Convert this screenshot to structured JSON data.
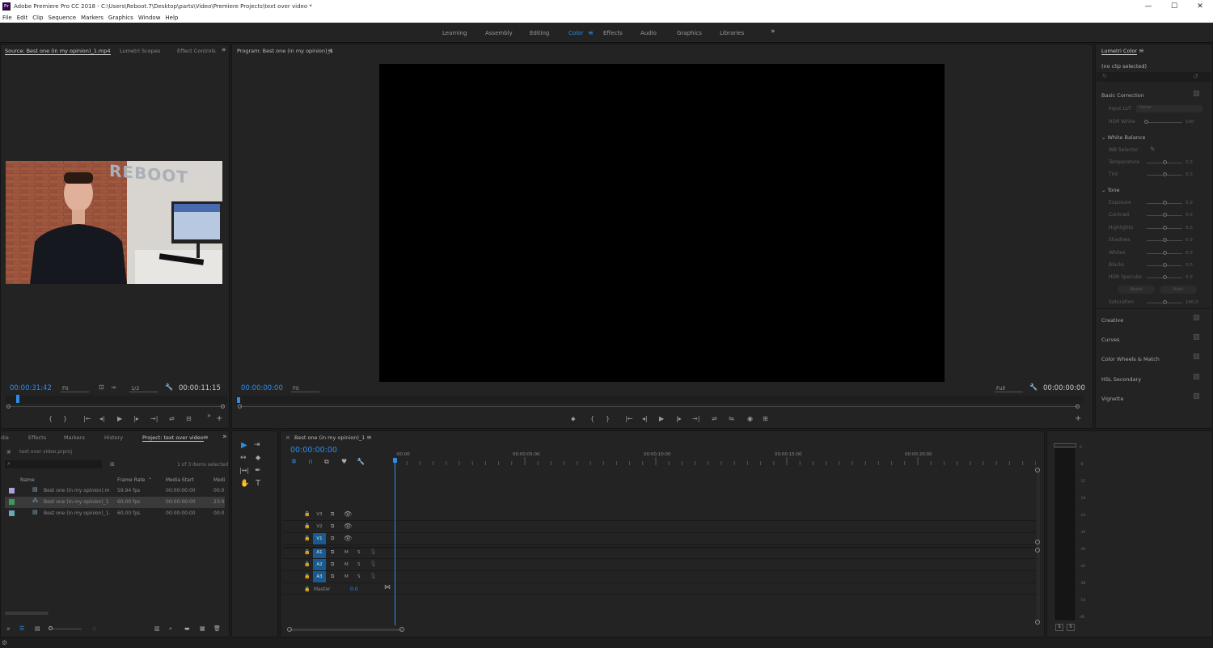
{
  "window": {
    "title": "Adobe Premiere Pro CC 2018 - C:\\Users\\Reboot.7\\Desktop\\parts\\Video\\Premiere Projects\\text over video *",
    "app_icon": "Pr",
    "buttons": [
      "—",
      "☐",
      "✕"
    ]
  },
  "menu": [
    "File",
    "Edit",
    "Clip",
    "Sequence",
    "Markers",
    "Graphics",
    "Window",
    "Help"
  ],
  "workspaces": {
    "items": [
      "Learning",
      "Assembly",
      "Editing",
      "Color",
      "Effects",
      "Audio",
      "Graphics",
      "Libraries"
    ],
    "active": "Color",
    "more": "»"
  },
  "source_panel": {
    "tabs": [
      "Source: Best one (in my opinion)_1.mp4",
      "Lumetri Scopes",
      "Effect Controls"
    ],
    "more": "»",
    "video_text": "REBOOT",
    "timecode_current": "00:00:31:42",
    "fit": "Fit",
    "resolution": "1/2",
    "timecode_duration": "00:00:11:15",
    "controls": [
      "{",
      "}",
      "|←",
      "◂|",
      "▶",
      "|▸",
      "→|",
      "⇌",
      "⊟",
      "»",
      "+"
    ]
  },
  "program_panel": {
    "tab": "Program: Best one (in my opinion)_1",
    "timecode_current": "00:00:00:00",
    "fit": "Fit",
    "quality": "Full",
    "timecode_duration": "00:00:00:00",
    "controls": [
      "⬥",
      "{",
      "}",
      "|←",
      "◂|",
      "▶",
      "|▸",
      "→|",
      "⇌",
      "⇋",
      "◉",
      "⊞"
    ],
    "add": "+"
  },
  "project_panel": {
    "tabs": [
      "dia",
      "Effects",
      "Markers",
      "History",
      "Project: text over video"
    ],
    "project_file": "text over video.prproj",
    "selection_info": "1 of 3 items selected",
    "columns": [
      "Name",
      "Frame Rate",
      "Media Start",
      "Medi"
    ],
    "rows": [
      {
        "color": "#b0a0e0",
        "name": "Best one (in my opinion).m",
        "fps": "59.94 fps",
        "start": "00:00:00:00",
        "media": "00:0"
      },
      {
        "color": "#3a9a5a",
        "name": "Best one (in my opinion)_1",
        "fps": "60.00 fps",
        "start": "00:00:00:00",
        "media": "23:0"
      },
      {
        "color": "#6aaab8",
        "name": "Best one (in my opinion)_1.",
        "fps": "60.00 fps",
        "start": "00:00:00:00",
        "media": "00:0"
      }
    ]
  },
  "timeline": {
    "tab": "Best one (in my opinion)_1",
    "timecode": "00:00:00:00",
    "ruler_labels": [
      ":00:00",
      "00:00:05:00",
      "00:00:10:00",
      "00:00:15:00",
      "00:00:20:00"
    ],
    "video_tracks": [
      "V3",
      "V2",
      "V1"
    ],
    "audio_tracks": [
      "A1",
      "A2",
      "A3"
    ],
    "master_label": "Master",
    "master_value": "0.0",
    "m_label": "M",
    "s_label": "S"
  },
  "tools": [
    "▶",
    "⇥",
    "↔",
    "◆",
    "|↔|",
    "✒",
    "✋",
    "T"
  ],
  "audio_meter": {
    "scale": [
      "0",
      "-6",
      "-12",
      "-18",
      "-24",
      "-30",
      "-36",
      "-42",
      "-48",
      "-54",
      "dB"
    ],
    "solo_buttons": [
      "S",
      "S"
    ]
  },
  "lumetri": {
    "title": "Lumetri Color",
    "clip": "(no clip selected)",
    "fx": "fx",
    "basic_correction": "Basic Correction",
    "input_lut_label": "Input LUT",
    "input_lut_value": "None",
    "hdr_white_label": "HDR White",
    "hdr_white_value": "100",
    "white_balance": "White Balance",
    "wb_selector": "WB Selector",
    "wb_rows": [
      {
        "label": "Temperature",
        "value": "0.0"
      },
      {
        "label": "Tint",
        "value": "0.0"
      }
    ],
    "tone": "Tone",
    "tone_rows": [
      {
        "label": "Exposure",
        "value": "0.0"
      },
      {
        "label": "Contrast",
        "value": "0.0"
      },
      {
        "label": "Highlights",
        "value": "0.0"
      },
      {
        "label": "Shadows",
        "value": "0.0"
      },
      {
        "label": "Whites",
        "value": "0.0"
      },
      {
        "label": "Blacks",
        "value": "0.0"
      },
      {
        "label": "HDR Specular",
        "value": "0.0"
      }
    ],
    "reset_button": "Reset",
    "auto_button": "Auto",
    "saturation_label": "Saturation",
    "saturation_value": "100.0",
    "sections": [
      "Creative",
      "Curves",
      "Color Wheels & Match",
      "HSL Secondary",
      "Vignette"
    ]
  },
  "status": {
    "icon": "⚙"
  }
}
